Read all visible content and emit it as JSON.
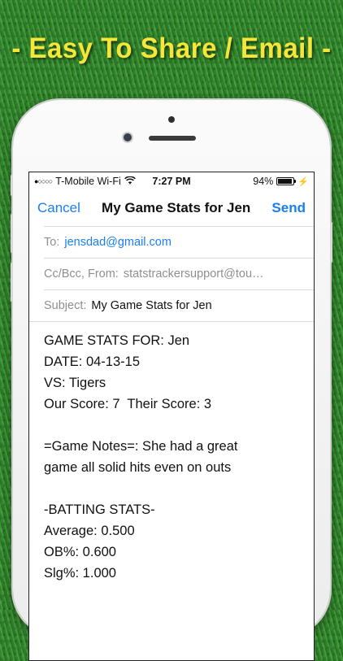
{
  "headline": "- Easy To Share / Email -",
  "status_bar": {
    "carrier": "T-Mobile Wi-Fi",
    "time": "7:27 PM",
    "battery": "94%",
    "battery_level": 0.94
  },
  "nav": {
    "cancel": "Cancel",
    "title": "My Game Stats for Jen",
    "send": "Send"
  },
  "fields": {
    "to_label": "To:",
    "to_value": "jensdad@gmail.com",
    "cc_label": "Cc/Bcc, From:",
    "cc_value": "statstrackersupport@tou…",
    "subject_label": "Subject:",
    "subject_value": "My Game Stats for Jen"
  },
  "body_lines": [
    "GAME STATS FOR: Jen",
    "DATE: 04-13-15",
    "VS: Tigers",
    "Our Score: 7  Their Score: 3",
    "",
    "=Game Notes=: She had a great",
    "game all solid hits even on outs",
    "",
    "-BATTING STATS-",
    "Average: 0.500",
    "OB%: 0.600",
    "Slg%: 1.000"
  ]
}
